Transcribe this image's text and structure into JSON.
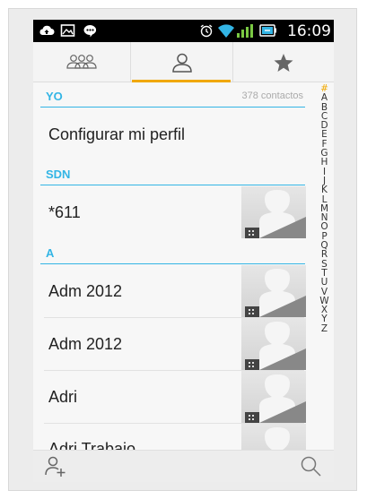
{
  "status_bar": {
    "time": "16:09",
    "icons": [
      "cloud-upload-icon",
      "image-icon",
      "chat-bubble-icon",
      "alarm-icon",
      "wifi-icon",
      "signal-icon",
      "battery-icon"
    ]
  },
  "tabs": [
    {
      "name": "groups",
      "icon": "groups-icon",
      "selected": false
    },
    {
      "name": "contacts",
      "icon": "person-icon",
      "selected": true
    },
    {
      "name": "favorites",
      "icon": "star-icon",
      "selected": false
    }
  ],
  "list": {
    "me_section": {
      "label": "YO",
      "count": "378 contactos"
    },
    "my_profile": "Configurar mi perfil",
    "sdn_section": {
      "label": "SDN"
    },
    "sdn_items": [
      {
        "name": "*611"
      }
    ],
    "a_section": {
      "label": "A"
    },
    "a_items": [
      {
        "name": "Adm 2012"
      },
      {
        "name": "Adm 2012"
      },
      {
        "name": "Adri"
      },
      {
        "name": "Adri Trabajo"
      }
    ]
  },
  "index_letters": [
    "#",
    "A",
    "B",
    "C",
    "D",
    "E",
    "F",
    "G",
    "H",
    "I",
    "J",
    "K",
    "L",
    "M",
    "N",
    "O",
    "P",
    "Q",
    "R",
    "S",
    "T",
    "U",
    "V",
    "W",
    "X",
    "Y",
    "Z"
  ],
  "bottom_bar": {
    "add_icon": "add-contact-icon",
    "search_icon": "search-icon"
  },
  "colors": {
    "accent": "#33b5e5",
    "tab_indicator": "#f0a800",
    "status_bar": "#000000"
  }
}
